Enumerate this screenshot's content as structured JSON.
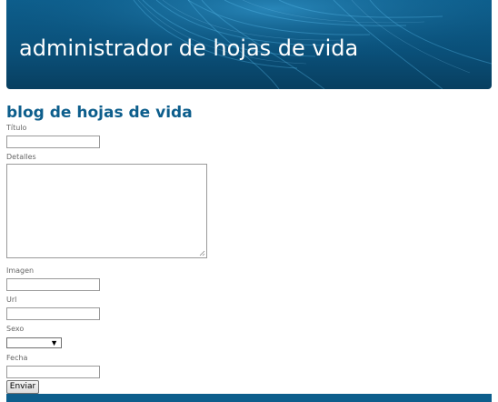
{
  "banner": {
    "title": "administrador de hojas de vida"
  },
  "form": {
    "heading": "blog de hojas de vida",
    "fields": {
      "titulo_label": "Título",
      "titulo_value": "",
      "detalles_label": "Detalles",
      "detalles_value": "",
      "imagen_label": "Imagen",
      "imagen_value": "",
      "url_label": "Url",
      "url_value": "",
      "sexo_label": "Sexo",
      "sexo_value": "",
      "fecha_label": "Fecha",
      "fecha_value": ""
    },
    "submit_label": "Enviar"
  },
  "colors": {
    "accent": "#0d5e8c",
    "text": "#666666"
  },
  "icons": {
    "select_arrow": "chevron-down-icon",
    "resize": "resize-grip-icon"
  }
}
